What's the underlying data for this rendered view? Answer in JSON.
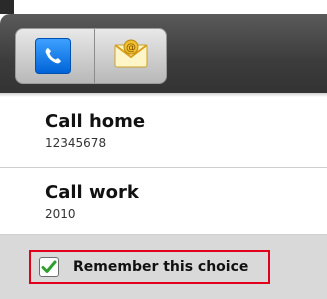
{
  "tabs": [
    {
      "icon": "phone-icon"
    },
    {
      "icon": "email-icon"
    }
  ],
  "items": [
    {
      "title": "Call home",
      "subtitle": "12345678"
    },
    {
      "title": "Call work",
      "subtitle": "2010"
    }
  ],
  "remember": {
    "label": "Remember this choice",
    "checked": true,
    "accent": "#2e9f2e",
    "highlight": "#e0001a"
  }
}
